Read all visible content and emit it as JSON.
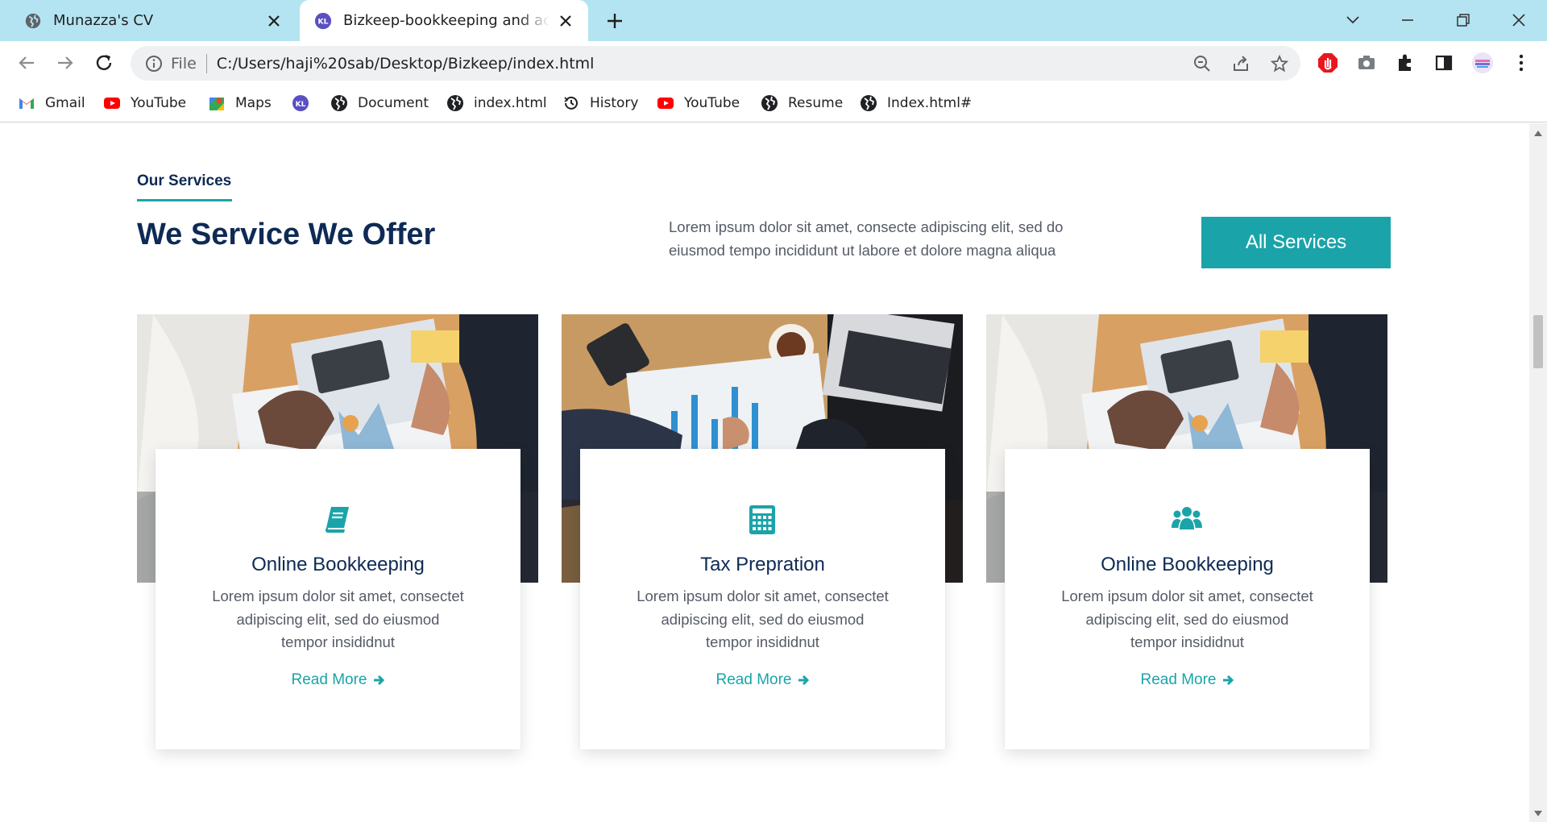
{
  "browser": {
    "tabs": [
      {
        "title": "Munazza's CV",
        "active": false
      },
      {
        "title": "Bizkeep-bookkeeping and accounting",
        "active": true
      }
    ],
    "address": {
      "scheme_label": "File",
      "url": "C:/Users/haji%20sab/Desktop/Bizkeep/index.html"
    },
    "bookmarks": [
      {
        "label": "Gmail",
        "icon": "gmail-icon"
      },
      {
        "label": "YouTube",
        "icon": "youtube-icon"
      },
      {
        "label": "Maps",
        "icon": "maps-icon"
      },
      {
        "label": "",
        "icon": "bizkeep-logo-icon"
      },
      {
        "label": "Document",
        "icon": "globe-icon"
      },
      {
        "label": "index.html",
        "icon": "globe-icon"
      },
      {
        "label": "History",
        "icon": "history-icon"
      },
      {
        "label": "YouTube",
        "icon": "youtube-icon"
      },
      {
        "label": "Resume",
        "icon": "globe-icon"
      },
      {
        "label": "Index.html#",
        "icon": "globe-icon"
      }
    ]
  },
  "services": {
    "eyebrow": "Our Services",
    "title": "We Service We Offer",
    "description": "Lorem ipsum dolor sit amet, consecte adipiscing elit, sed do eiusmod tempo incididunt ut labore et dolore magna aliqua",
    "button_label": "All Services",
    "cards": [
      {
        "icon": "book-icon",
        "title": "Online Bookkeeping",
        "text": "Lorem ipsum dolor sit amet, consectet adipiscing elit, sed do eiusmod tempor insididnut",
        "link": "Read More"
      },
      {
        "icon": "calculator-icon",
        "title": "Tax Prepration",
        "text": "Lorem ipsum dolor sit amet, consectet adipiscing elit, sed do eiusmod tempor insididnut",
        "link": "Read More"
      },
      {
        "icon": "users-icon",
        "title": "Online Bookkeeping",
        "text": "Lorem ipsum dolor sit amet, consectet adipiscing elit, sed do eiusmod tempor insididnut",
        "link": "Read More"
      }
    ]
  },
  "colors": {
    "accent": "#1aa4a9",
    "heading": "#0e2a55",
    "body_text": "#555a66",
    "tabstrip": "#b4e4f1"
  }
}
